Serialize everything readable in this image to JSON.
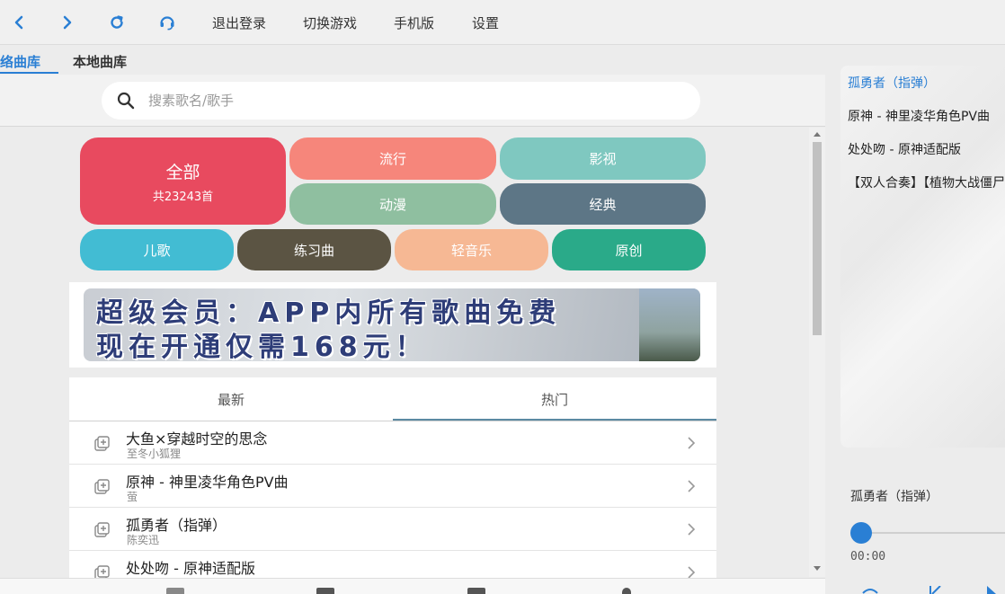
{
  "toolbar": {
    "back_icon": "chevron-left-icon",
    "forward_icon": "chevron-right-icon",
    "refresh_icon": "refresh-icon",
    "support_icon": "headset-icon",
    "logout_label": "退出登录",
    "switch_game_label": "切换游戏",
    "mobile_label": "手机版",
    "settings_label": "设置",
    "accent_color": "#2a7fd4"
  },
  "library_tabs": [
    {
      "label": "络曲库",
      "active": true
    },
    {
      "label": "本地曲库",
      "active": false
    }
  ],
  "search": {
    "placeholder": "搜素歌名/歌手",
    "icon": "search-icon"
  },
  "categories": {
    "all": {
      "label": "全部",
      "count_label": "共23243首",
      "color": "#e84a5f"
    },
    "items": [
      {
        "label": "流行",
        "color": "#f6867b"
      },
      {
        "label": "影视",
        "color": "#7fc8c0"
      },
      {
        "label": "动漫",
        "color": "#8fbfa0"
      },
      {
        "label": "经典",
        "color": "#5d7686"
      },
      {
        "label": "儿歌",
        "color": "#42bcd3"
      },
      {
        "label": "练习曲",
        "color": "#5b5443"
      },
      {
        "label": "轻音乐",
        "color": "#f6b894"
      },
      {
        "label": "原创",
        "color": "#2aaa89"
      }
    ]
  },
  "banner": {
    "line1": "超级会员：APP内所有歌曲免费",
    "line2": "现在开通仅需168元！"
  },
  "song_tabs": [
    {
      "label": "最新",
      "active": false
    },
    {
      "label": "热门",
      "active": true
    }
  ],
  "songs": [
    {
      "title": "大鱼×穿越时空的思念",
      "artist": "至冬小狐狸"
    },
    {
      "title": "原神 - 神里凌华角色PV曲",
      "artist": "萤"
    },
    {
      "title": "孤勇者（指弹）",
      "artist": "陈奕迅"
    },
    {
      "title": "处处吻 - 原神适配版",
      "artist": ""
    }
  ],
  "playlist": [
    {
      "title": "孤勇者（指弹）",
      "current": true
    },
    {
      "title": "原神 - 神里凌华角色PV曲",
      "current": false
    },
    {
      "title": "处处吻 - 原神适配版",
      "current": false
    },
    {
      "title": "【双人合奏】【植物大战僵尸",
      "current": false
    }
  ],
  "player": {
    "now_playing": "孤勇者（指弹）",
    "time": "00:00",
    "progress": 0
  }
}
